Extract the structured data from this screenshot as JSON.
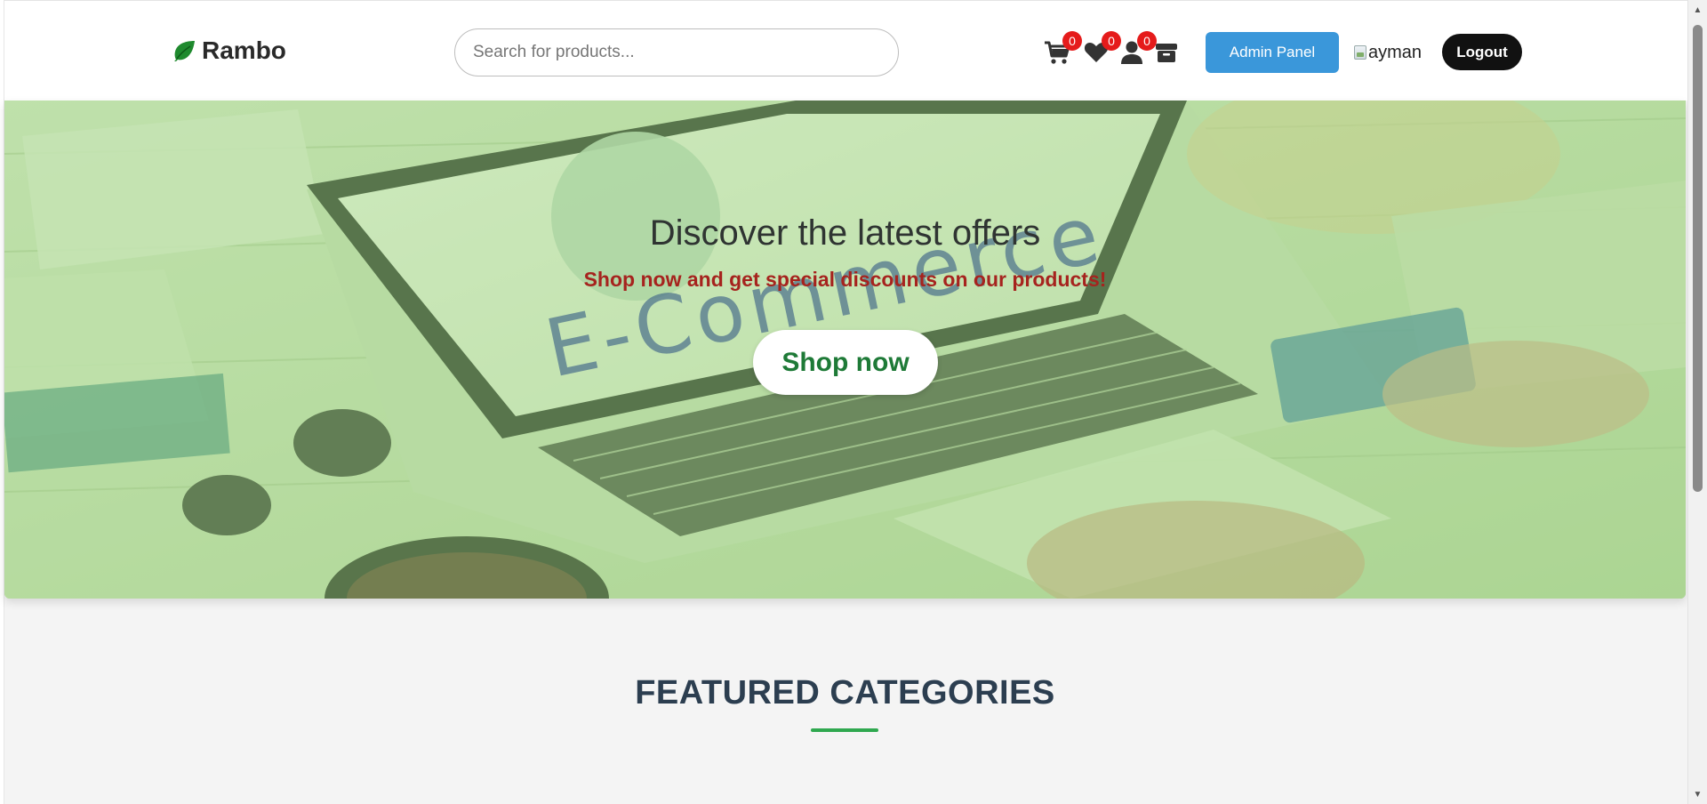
{
  "header": {
    "logo_text": "Rambo",
    "search_placeholder": "Search for products...",
    "cart_count": "0",
    "wishlist_count": "0",
    "profile_count": "0",
    "admin_label": "Admin Panel",
    "avatar_alt": "ayman",
    "logout_label": "Logout"
  },
  "hero": {
    "title": "Discover the latest offers",
    "subtitle": "Shop now and get special discounts on our products!",
    "cta_label": "Shop now",
    "image_text": "E-Commerce"
  },
  "featured": {
    "title": "FEATURED CATEGORIES"
  },
  "colors": {
    "brand_green": "#1e7a37",
    "accent_blue": "#3a97da",
    "badge_red": "#e51b1b",
    "subtitle_red": "#a6231e",
    "heading_navy": "#2c3e50"
  },
  "icons": [
    "leaf-icon",
    "cart-icon",
    "heart-icon",
    "user-icon",
    "box-icon"
  ]
}
